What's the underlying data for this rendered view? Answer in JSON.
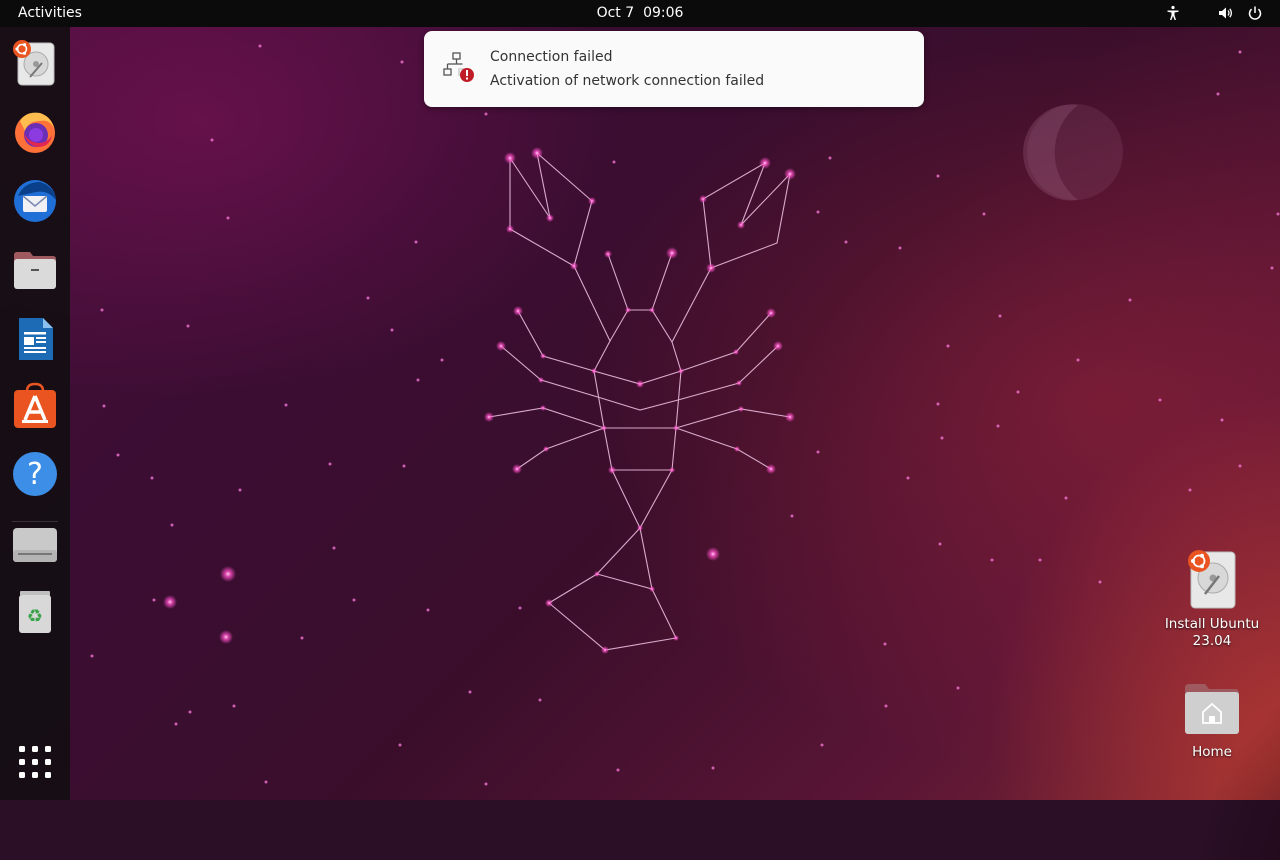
{
  "topbar": {
    "activities_label": "Activities",
    "date": "Oct 7",
    "time": "09:06",
    "tray": [
      "accessibility-icon",
      "volume-icon",
      "power-icon"
    ]
  },
  "notification": {
    "icon": "network-error-icon",
    "title": "Connection failed",
    "body": "Activation of network connection failed"
  },
  "dock": {
    "items": [
      {
        "name": "install-ubuntu",
        "icon": "installer-icon"
      },
      {
        "name": "firefox",
        "icon": "firefox-icon"
      },
      {
        "name": "thunderbird",
        "icon": "thunderbird-icon"
      },
      {
        "name": "files",
        "icon": "files-icon"
      },
      {
        "name": "libreoffice-writer",
        "icon": "writer-icon"
      },
      {
        "name": "app-center",
        "icon": "app-store-icon"
      },
      {
        "name": "help",
        "icon": "help-icon"
      },
      {
        "name": "drive",
        "icon": "drive-icon"
      },
      {
        "name": "trash",
        "icon": "trash-icon"
      },
      {
        "name": "show-apps",
        "icon": "app-grid-icon"
      }
    ]
  },
  "desktop": {
    "icons": [
      {
        "label": "Install Ubuntu 23.04",
        "icon": "installer-icon"
      },
      {
        "label": "Home",
        "icon": "home-folder-icon"
      }
    ]
  },
  "colors": {
    "topbar": "#0b0b0b",
    "accent_orange": "#e95420",
    "notification_bg": "#fafafa",
    "error_red": "#c01c28"
  }
}
